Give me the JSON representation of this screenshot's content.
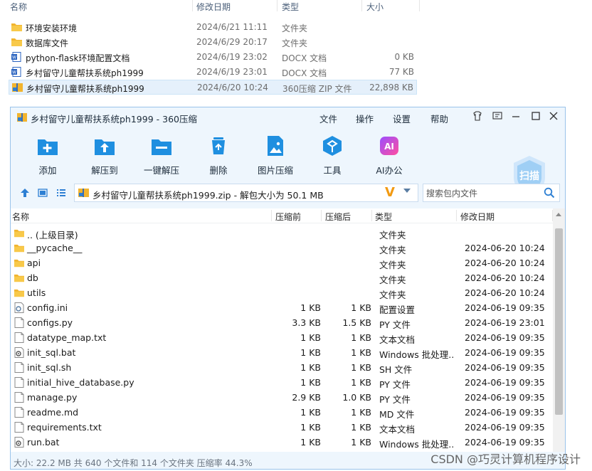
{
  "explorer": {
    "columns": {
      "name": "名称",
      "date": "修改日期",
      "type": "类型",
      "size": "大小"
    },
    "rows": [
      {
        "name": "环境安装环境",
        "date": "2024/6/21 11:11",
        "type": "文件夹",
        "size": "",
        "icon": "folder-icon"
      },
      {
        "name": "数据库文件",
        "date": "2024/6/29 20:17",
        "type": "文件夹",
        "size": "",
        "icon": "folder-icon"
      },
      {
        "name": "python-flask环境配置文档",
        "date": "2024/6/19 23:02",
        "type": "DOCX 文档",
        "size": "0 KB",
        "icon": "word-doc-icon"
      },
      {
        "name": "乡村留守儿童帮扶系统ph1999",
        "date": "2024/6/19 23:01",
        "type": "DOCX 文档",
        "size": "77 KB",
        "icon": "word-doc-icon"
      },
      {
        "name": "乡村留守儿童帮扶系统ph1999",
        "date": "2024/6/20 10:24",
        "type": "360压缩 ZIP 文件",
        "size": "22,898 KB",
        "icon": "zip-archive-icon",
        "selected": true
      }
    ]
  },
  "window": {
    "title": "乡村留守儿童帮扶系统ph1999 - 360压缩",
    "menu": [
      "文件",
      "操作",
      "设置",
      "帮助"
    ],
    "toolbar": [
      {
        "label": "添加",
        "icon": "add-icon"
      },
      {
        "label": "解压到",
        "icon": "extract-to-icon"
      },
      {
        "label": "一键解压",
        "icon": "one-click-extract-icon"
      },
      {
        "label": "删除",
        "icon": "delete-icon"
      },
      {
        "label": "图片压缩",
        "icon": "image-compress-icon"
      },
      {
        "label": "工具",
        "icon": "tools-icon"
      },
      {
        "label": "AI办公",
        "icon": "ai-office-icon"
      }
    ],
    "scan_label": "扫描",
    "path_text": "乡村留守儿童帮扶系统ph1999.zip - 解包大小为 50.1 MB",
    "search_placeholder": "搜索包内文件",
    "file_columns": {
      "name": "名称",
      "before": "压缩前",
      "after": "压缩后",
      "type": "类型",
      "date": "修改日期"
    },
    "files": [
      {
        "name": ".. (上级目录)",
        "before": "",
        "after": "",
        "type": "文件夹",
        "date": "",
        "icon": "folder-icon"
      },
      {
        "name": "__pycache__",
        "before": "",
        "after": "",
        "type": "文件夹",
        "date": "2024-06-20 10:24",
        "icon": "folder-icon"
      },
      {
        "name": "api",
        "before": "",
        "after": "",
        "type": "文件夹",
        "date": "2024-06-20 10:24",
        "icon": "folder-icon"
      },
      {
        "name": "db",
        "before": "",
        "after": "",
        "type": "文件夹",
        "date": "2024-06-20 10:24",
        "icon": "folder-icon"
      },
      {
        "name": "utils",
        "before": "",
        "after": "",
        "type": "文件夹",
        "date": "2024-06-20 10:24",
        "icon": "folder-icon"
      },
      {
        "name": "config.ini",
        "before": "1 KB",
        "after": "1 KB",
        "type": "配置设置",
        "date": "2024-06-19 09:35",
        "icon": "config-file-icon"
      },
      {
        "name": "configs.py",
        "before": "3.3 KB",
        "after": "1.5 KB",
        "type": "PY 文件",
        "date": "2024-06-19 23:01",
        "icon": "file-icon"
      },
      {
        "name": "datatype_map.txt",
        "before": "1 KB",
        "after": "1 KB",
        "type": "文本文档",
        "date": "2024-06-19 09:35",
        "icon": "file-icon"
      },
      {
        "name": "init_sql.bat",
        "before": "1 KB",
        "after": "1 KB",
        "type": "Windows 批处理...",
        "date": "2024-06-19 09:35",
        "icon": "batch-file-icon"
      },
      {
        "name": "init_sql.sh",
        "before": "1 KB",
        "after": "1 KB",
        "type": "SH 文件",
        "date": "2024-06-19 09:35",
        "icon": "file-icon"
      },
      {
        "name": "initial_hive_database.py",
        "before": "1 KB",
        "after": "1 KB",
        "type": "PY 文件",
        "date": "2024-06-19 09:35",
        "icon": "file-icon"
      },
      {
        "name": "manage.py",
        "before": "2.9 KB",
        "after": "1.0 KB",
        "type": "PY 文件",
        "date": "2024-06-19 09:35",
        "icon": "file-icon"
      },
      {
        "name": "readme.md",
        "before": "1 KB",
        "after": "1 KB",
        "type": "MD 文件",
        "date": "2024-06-19 09:35",
        "icon": "file-icon"
      },
      {
        "name": "requirements.txt",
        "before": "1 KB",
        "after": "1 KB",
        "type": "文本文档",
        "date": "2024-06-19 09:35",
        "icon": "file-icon"
      },
      {
        "name": "run.bat",
        "before": "1 KB",
        "after": "1 KB",
        "type": "Windows 批处理...",
        "date": "2024-06-19 09:35",
        "icon": "batch-file-icon"
      }
    ],
    "status": "大小: 22.2 MB 共 640 个文件和 114 个文件夹 压缩率 44.3%"
  },
  "watermark": "CSDN @巧灵计算机程序设计",
  "colors": {
    "accent": "#2d7fd3",
    "window_bg": "#eef6fd",
    "folder": "#f2b42e",
    "selection": "#e5f0fb"
  }
}
